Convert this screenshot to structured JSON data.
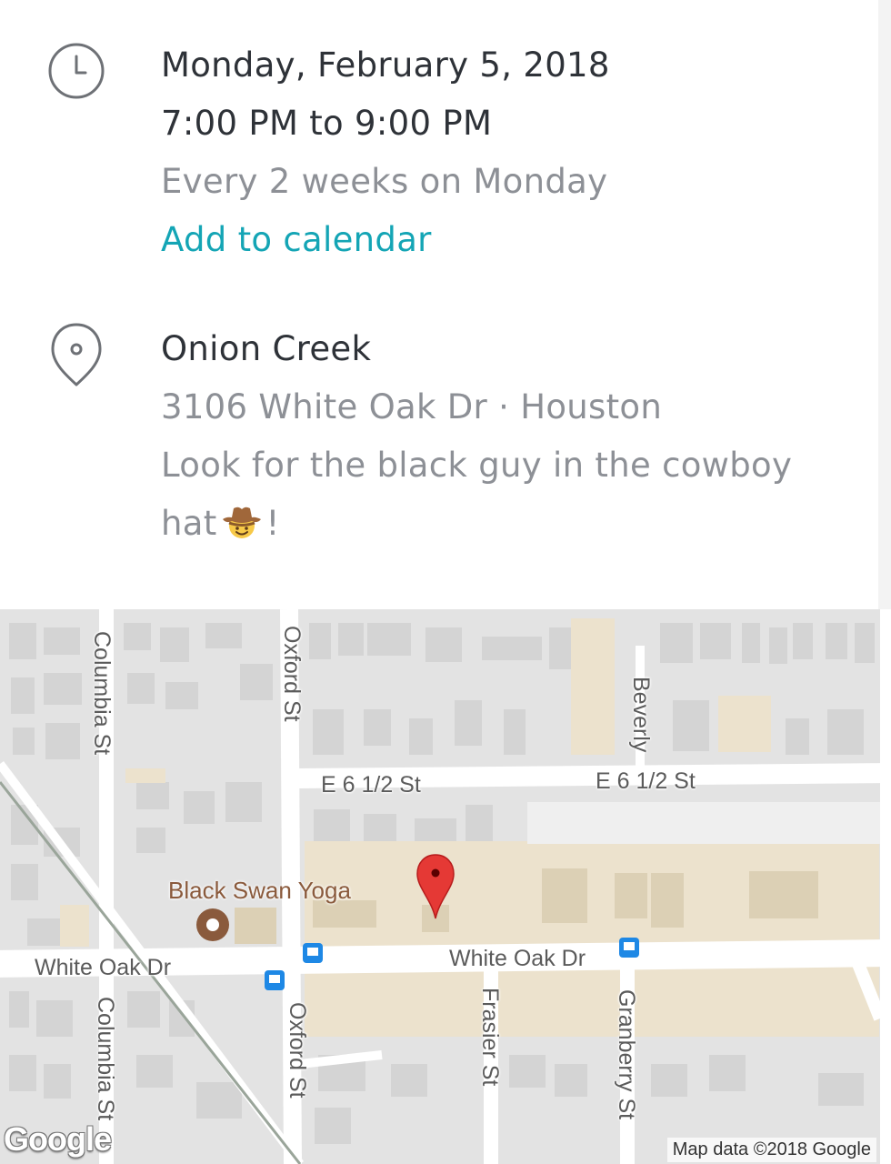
{
  "event": {
    "date": "Monday, February 5, 2018",
    "time": "7:00 PM to 9:00 PM",
    "recurrence": "Every 2 weeks on Monday",
    "add_to_calendar": "Add to calendar"
  },
  "location": {
    "venue": "Onion Creek",
    "address": "3106 White Oak Dr · Houston",
    "note_line1": "Look for the black guy in the cowboy",
    "note_line2_prefix": "hat",
    "note_line2_suffix": "!",
    "note_emoji": "cowboy-hat-face-emoji"
  },
  "map": {
    "streets": {
      "columbia_top": "Columbia St",
      "oxford_top": "Oxford St",
      "beverly": "Beverly",
      "e612_left": "E 6 1/2 St",
      "e612_right": "E 6 1/2 St",
      "white_oak_left": "White Oak Dr",
      "white_oak_right": "White Oak Dr",
      "columbia_bottom": "Columbia St",
      "oxford_bottom": "Oxford St",
      "frasier": "Frasier St",
      "granberry": "Granberry St"
    },
    "poi": "Black Swan Yoga",
    "logo": "Google",
    "attribution": "Map data ©2018 Google",
    "colors": {
      "road": "#ffffff",
      "block": "#e3e3e3",
      "building": "#d2d2d2",
      "commercial": "#ece2cd",
      "pin": "#e53935",
      "transit": "#1e88e5"
    }
  }
}
